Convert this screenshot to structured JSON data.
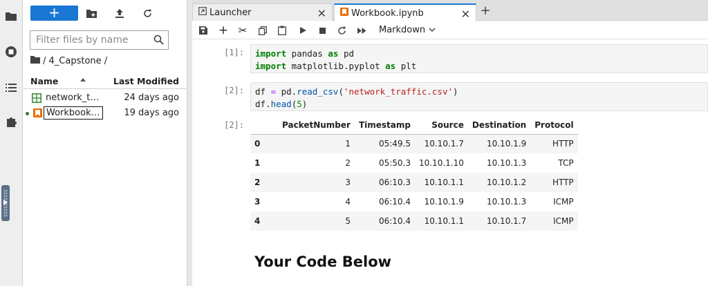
{
  "sidebar_icons": [
    "folder-icon",
    "running-icon",
    "toc-icon",
    "extension-icon"
  ],
  "file_browser": {
    "new_button": "+",
    "filter_placeholder": "Filter files by name",
    "breadcrumb": "/ 4_Capstone /",
    "col_name": "Name",
    "col_modified": "Last Modified",
    "files": [
      {
        "name": "network_t…",
        "modified": "24 days ago",
        "type": "csv"
      },
      {
        "name": "Workbook…",
        "modified": "19 days ago",
        "type": "notebook"
      }
    ]
  },
  "tabs": [
    {
      "label": "Launcher"
    },
    {
      "label": "Workbook.ipynb"
    }
  ],
  "notebook": {
    "cell_type": "Markdown",
    "cells": [
      {
        "prompt": "[1]:"
      },
      {
        "prompt": "[2]:"
      },
      {
        "prompt": "[2]:"
      }
    ],
    "code1_line1": [
      "import",
      " pandas ",
      "as",
      " pd"
    ],
    "code1_line2": [
      "import",
      " matplotlib.pyplot ",
      "as",
      " plt"
    ],
    "code2_line1": [
      "df ",
      "=",
      " pd.",
      "read_csv",
      "(",
      "'network_traffic.csv'",
      ")"
    ],
    "code2_line2": [
      "df.",
      "head",
      "(",
      "5",
      ")"
    ],
    "table": {
      "columns": [
        "PacketNumber",
        "Timestamp",
        "Source",
        "Destination",
        "Protocol"
      ],
      "rows": [
        [
          "0",
          "1",
          "05:49.5",
          "10.10.1.7",
          "10.10.1.9",
          "HTTP"
        ],
        [
          "1",
          "2",
          "05:50.3",
          "10.10.1.10",
          "10.10.1.3",
          "TCP"
        ],
        [
          "2",
          "3",
          "06:10.3",
          "10.10.1.1",
          "10.10.1.2",
          "HTTP"
        ],
        [
          "3",
          "4",
          "06:10.4",
          "10.10.1.9",
          "10.10.1.3",
          "ICMP"
        ],
        [
          "4",
          "5",
          "06:10.4",
          "10.10.1.1",
          "10.10.1.7",
          "ICMP"
        ]
      ]
    },
    "markdown_heading": "Your Code Below"
  }
}
